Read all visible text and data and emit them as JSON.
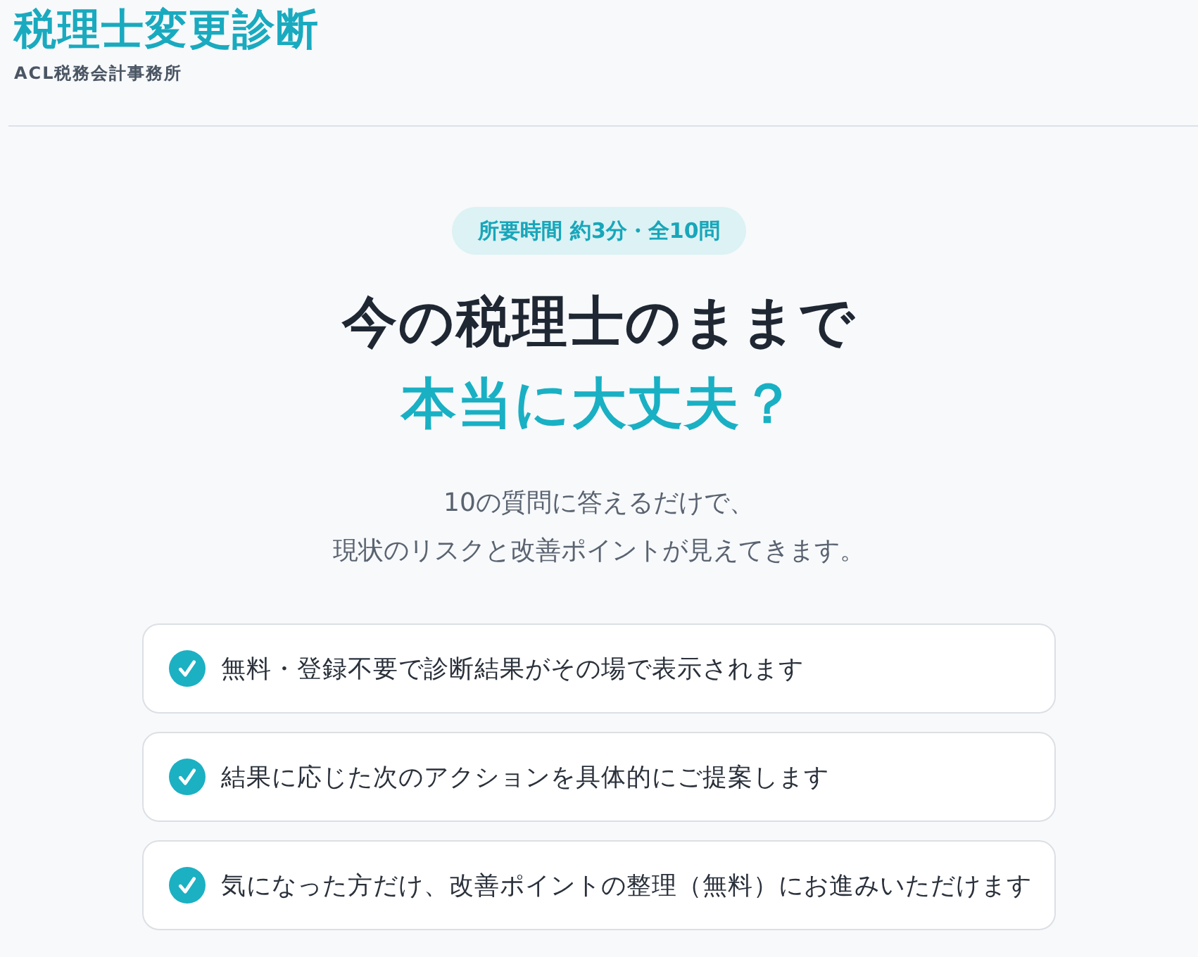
{
  "header": {
    "title": "税理士変更診断",
    "subtitle": "ACL税務会計事務所"
  },
  "badge": "所要時間 約3分・全10問",
  "headline": [
    {
      "text": "今の税理士のままで",
      "kind": "plain"
    },
    {
      "text": "本当に大丈夫？",
      "kind": "accent"
    }
  ],
  "lead": {
    "lines": [
      "10の質問に答えるだけで、",
      "現状のリスクと改善ポイントが見えてきます。"
    ]
  },
  "features": [
    {
      "text": "無料・登録不要で診断結果がその場で表示されます"
    },
    {
      "text": "結果に応じた次のアクションを具体的にご提案します"
    },
    {
      "text": "気になった方だけ、改善ポイントの整理（無料）にお進みいただけます"
    }
  ]
}
